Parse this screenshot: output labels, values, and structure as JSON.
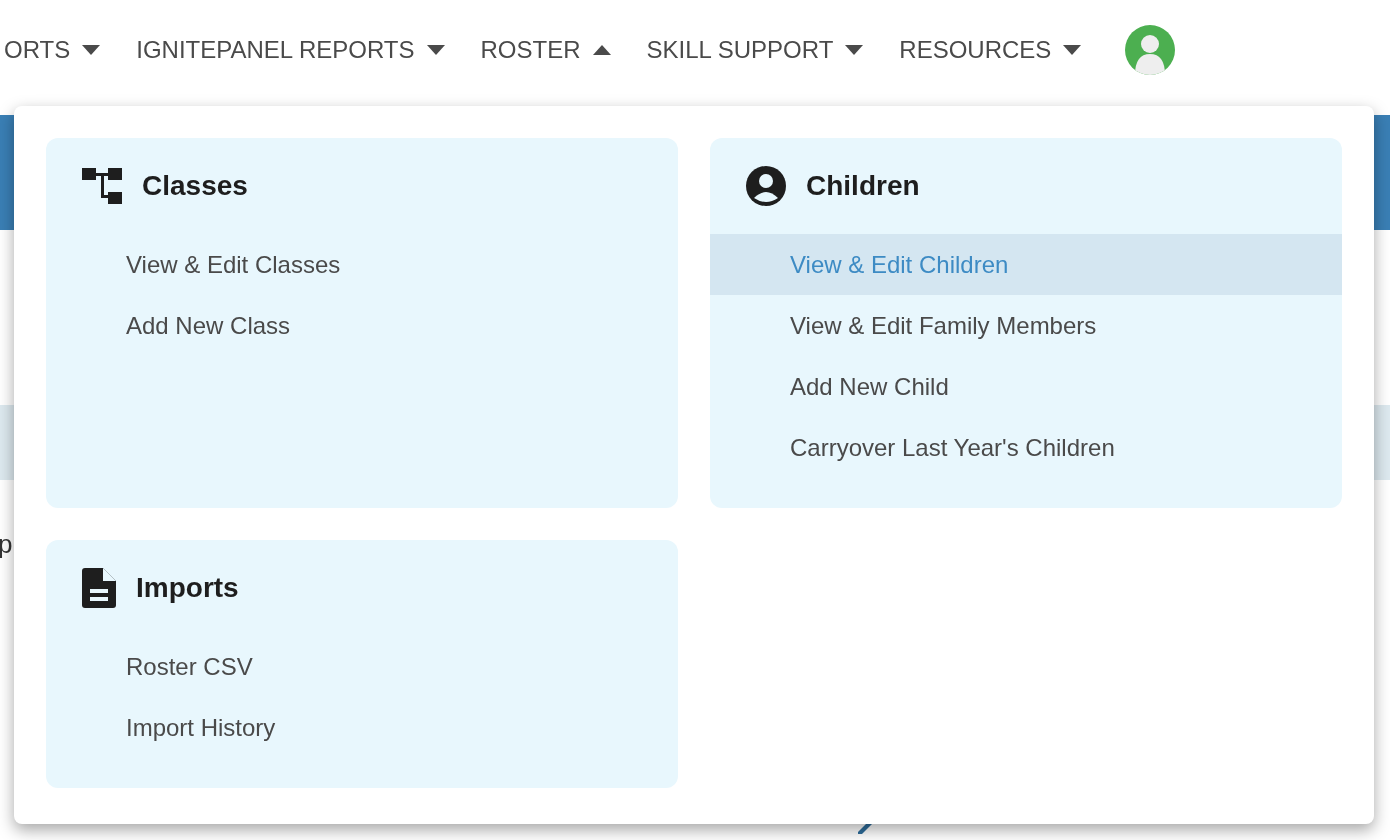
{
  "nav": {
    "items": [
      {
        "label": "ORTS",
        "expanded": false
      },
      {
        "label": "IGNITEPANEL REPORTS",
        "expanded": false
      },
      {
        "label": "ROSTER",
        "expanded": true
      },
      {
        "label": "SKILL SUPPORT",
        "expanded": false
      },
      {
        "label": "RESOURCES",
        "expanded": false
      }
    ]
  },
  "dropdown": {
    "sections": [
      {
        "title": "Classes",
        "kind": "tree",
        "items": [
          {
            "label": "View & Edit Classes",
            "selected": false
          },
          {
            "label": "Add New Class",
            "selected": false
          }
        ]
      },
      {
        "title": "Children",
        "kind": "person",
        "items": [
          {
            "label": "View & Edit Children",
            "selected": true
          },
          {
            "label": "View & Edit Family Members",
            "selected": false
          },
          {
            "label": "Add New Child",
            "selected": false
          },
          {
            "label": "Carryover Last Year's Children",
            "selected": false
          }
        ]
      },
      {
        "title": "Imports",
        "kind": "file",
        "items": [
          {
            "label": "Roster CSV",
            "selected": false
          },
          {
            "label": "Import History",
            "selected": false
          }
        ]
      }
    ]
  },
  "page": {
    "texts": [
      "p"
    ]
  }
}
